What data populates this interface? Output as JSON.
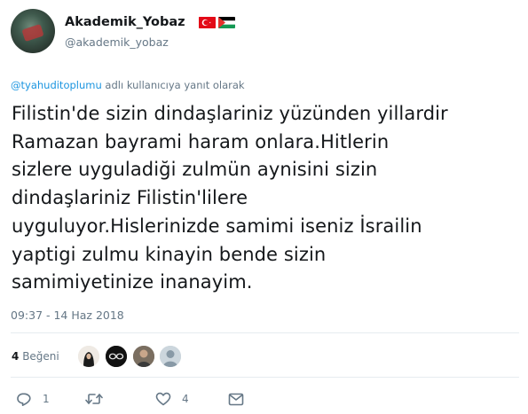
{
  "author": {
    "display_name": "Akademik_Yobaz",
    "handle": "@akademik_yobaz",
    "avatar_icon": "avatar-photo",
    "flags": [
      "turkey-flag-icon",
      "palestine-flag-icon"
    ]
  },
  "reply_context": {
    "mention": "@tyahuditoplumu",
    "suffix": " adlı kullanıcıya yanıt olarak"
  },
  "tweet": {
    "text": "Filistin'de sizin dindaşlariniz yüzünden yillardir\nRamazan bayrami haram onlara.Hitlerin\nsizlere uyguladiği zulmün aynisini sizin\ndindaşlariniz Filistin'lilere\nuyguluyor.Hislerinizde samimi iseniz İsrailin\nyaptigi zulmu kinayin bende sizin\nsamimiyetinize inanayim.",
    "timestamp": "09:37 - 14 Haz 2018"
  },
  "likes": {
    "count": "4",
    "label": "Beğeni"
  },
  "actions": {
    "reply_count": "1",
    "retweet_count": "",
    "like_count": "4"
  },
  "colors": {
    "text": "#14171a",
    "secondary": "#657786",
    "link": "#1b95e0",
    "divider": "#e6ecf0"
  }
}
